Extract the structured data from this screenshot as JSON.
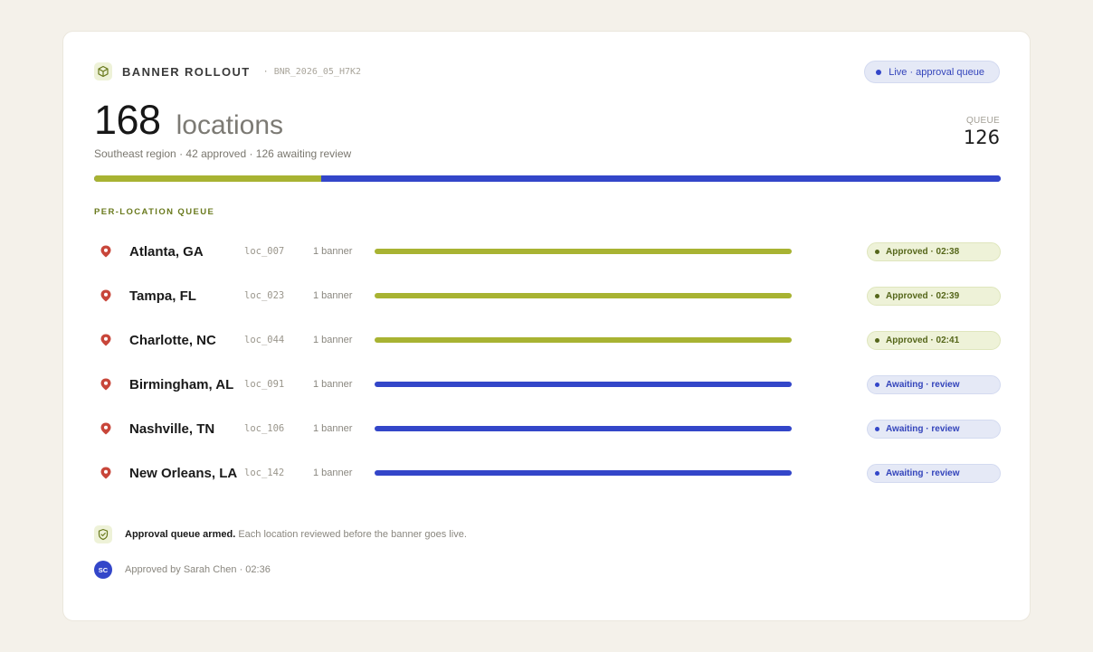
{
  "header": {
    "brand": "BANNER ROLLOUT",
    "code": "· BNR_2026_05_H7K2",
    "live_badge": "Live · approval queue"
  },
  "summary": {
    "count": "168",
    "unit": "locations",
    "subtitle": "Southeast region · 42 approved · 126 awaiting review",
    "queue_label": "QUEUE",
    "queue_value": "126",
    "approved_fraction": 0.25
  },
  "section_title": "PER-LOCATION QUEUE",
  "locations": [
    {
      "city": "Atlanta, GA",
      "id": "loc_007",
      "banners": "1 banner",
      "state": "approved",
      "status": "Approved · 02:38"
    },
    {
      "city": "Tampa, FL",
      "id": "loc_023",
      "banners": "1 banner",
      "state": "approved",
      "status": "Approved · 02:39"
    },
    {
      "city": "Charlotte, NC",
      "id": "loc_044",
      "banners": "1 banner",
      "state": "approved",
      "status": "Approved · 02:41"
    },
    {
      "city": "Birmingham, AL",
      "id": "loc_091",
      "banners": "1 banner",
      "state": "awaiting",
      "status": "Awaiting · review"
    },
    {
      "city": "Nashville, TN",
      "id": "loc_106",
      "banners": "1 banner",
      "state": "awaiting",
      "status": "Awaiting · review"
    },
    {
      "city": "New Orleans, LA",
      "id": "loc_142",
      "banners": "1 banner",
      "state": "awaiting",
      "status": "Awaiting · review"
    }
  ],
  "footer": {
    "armed_bold": "Approval queue armed.",
    "armed_text": " Each location reviewed before the banner goes live.",
    "avatar_initials": "SC",
    "approved_by": "Approved by Sarah Chen · 02:36"
  },
  "colors": {
    "approved": "#a8b332",
    "awaiting": "#3346c9",
    "pin": "#c8463a",
    "background": "#f4f1ea"
  }
}
